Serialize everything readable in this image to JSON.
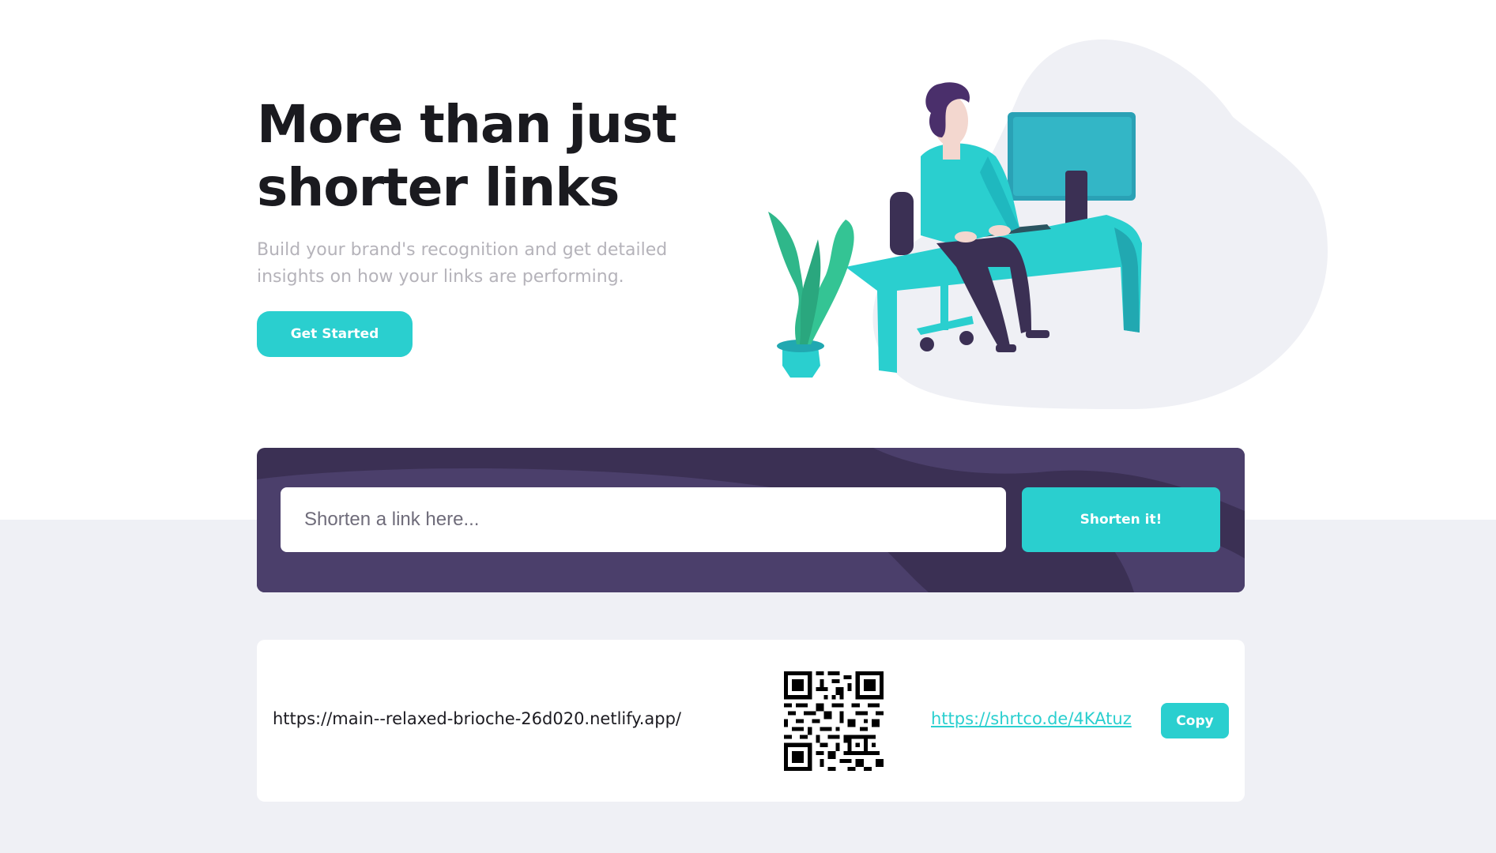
{
  "hero": {
    "title_line1": "More than just",
    "title_line2": "shorter links",
    "subtitle_line1": "Build your brand's recognition and get detailed",
    "subtitle_line2": "insights on how your links are performing.",
    "cta_label": "Get Started",
    "illustration_icon": "person-working-at-desk-illustration"
  },
  "shortener": {
    "input_placeholder": "Shorten a link here...",
    "input_value": "",
    "button_label": "Shorten it!"
  },
  "results": [
    {
      "original_url": "https://main--relaxed-brioche-26d020.netlify.app/",
      "short_url": "https://shrtco.de/4KAtuz",
      "copy_label": "Copy",
      "qr_icon": "qr-code-icon"
    }
  ],
  "colors": {
    "accent": "#2acfcf",
    "dark_violet": "#3b3054",
    "light_bg": "#eff0f5",
    "heading": "#1a1a1f",
    "muted_text": "#b5b3ba"
  }
}
